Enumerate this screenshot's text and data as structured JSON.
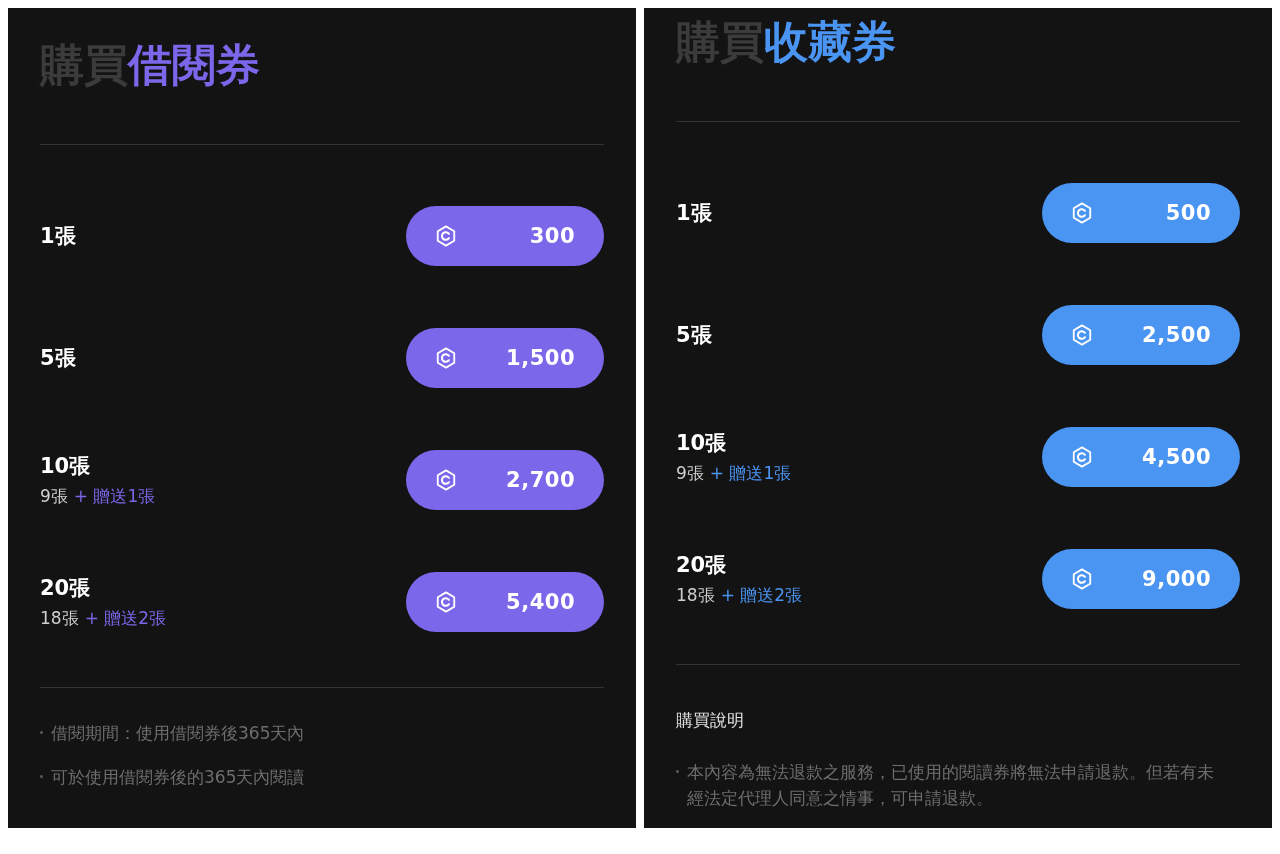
{
  "panels": [
    {
      "title": {
        "prefix": "購買",
        "highlight": "借閱券"
      },
      "color": "#7b67ea",
      "options": [
        {
          "quantity": "1張",
          "price": "300"
        },
        {
          "quantity": "5張",
          "price": "1,500"
        },
        {
          "quantity": "10張",
          "base": "9張",
          "bonus": "+ 贈送1張",
          "price": "2,700"
        },
        {
          "quantity": "20張",
          "base": "18張",
          "bonus": "+ 贈送2張",
          "price": "5,400"
        }
      ],
      "notes": [
        "借閱期間：使用借閱券後365天內",
        "可於使用借閱券後的365天內閱讀"
      ]
    },
    {
      "title": {
        "prefix": "購買",
        "highlight": "收藏券"
      },
      "color": "#4a94f2",
      "options": [
        {
          "quantity": "1張",
          "price": "500"
        },
        {
          "quantity": "5張",
          "price": "2,500"
        },
        {
          "quantity": "10張",
          "base": "9張",
          "bonus": "+ 贈送1張",
          "price": "4,500"
        },
        {
          "quantity": "20張",
          "base": "18張",
          "bonus": "+ 贈送2張",
          "price": "9,000"
        }
      ],
      "notes_heading": "購買說明",
      "notes": [
        "本內容為無法退款之服務，已使用的閱讀券將無法申請退款。但若有未經法定代理人同意之情事，可申請退款。"
      ]
    }
  ]
}
